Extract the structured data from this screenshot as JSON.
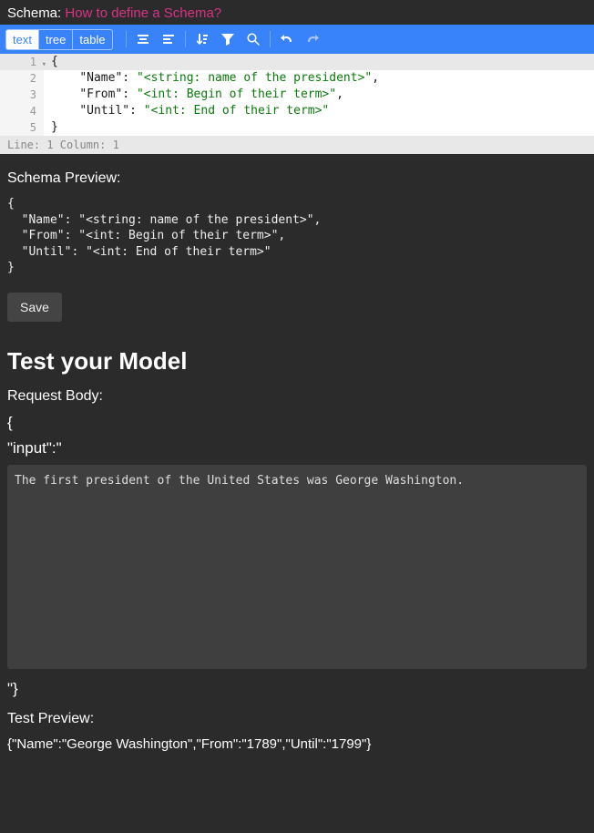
{
  "header": {
    "label": "Schema: ",
    "link": "How to define a Schema?"
  },
  "toolbar": {
    "modes": {
      "text": "text",
      "tree": "tree",
      "table": "table"
    },
    "active_mode": "text"
  },
  "editor": {
    "lines": [
      {
        "n": "1",
        "content": "{"
      },
      {
        "n": "2",
        "indent": "    ",
        "key": "\"Name\"",
        "colon": ": ",
        "val": "\"<string: name of the president>\"",
        "trail": ","
      },
      {
        "n": "3",
        "indent": "    ",
        "key": "\"From\"",
        "colon": ": ",
        "val": "\"<int: Begin of their term>\"",
        "trail": ","
      },
      {
        "n": "4",
        "indent": "    ",
        "key": "\"Until\"",
        "colon": ": ",
        "val": "\"<int: End of their term>\"",
        "trail": ""
      },
      {
        "n": "5",
        "content": "}"
      }
    ],
    "status": "Line: 1  Column: 1"
  },
  "schema_preview": {
    "label": "Schema Preview:",
    "text": "{\n  \"Name\": \"<string: name of the president>\",\n  \"From\": \"<int: Begin of their term>\",\n  \"Until\": \"<int: End of their term>\"\n}"
  },
  "save_label": "Save",
  "test": {
    "heading": "Test your Model",
    "request_body_label": "Request Body:",
    "open_brace": "{",
    "input_key": "\"input\":\"",
    "textarea_value": "The first president of the United States was George Washington.",
    "close": "\"}",
    "preview_label": "Test Preview:",
    "preview_text": "{\"Name\":\"George Washington\",\"From\":\"1789\",\"Until\":\"1799\"}"
  }
}
